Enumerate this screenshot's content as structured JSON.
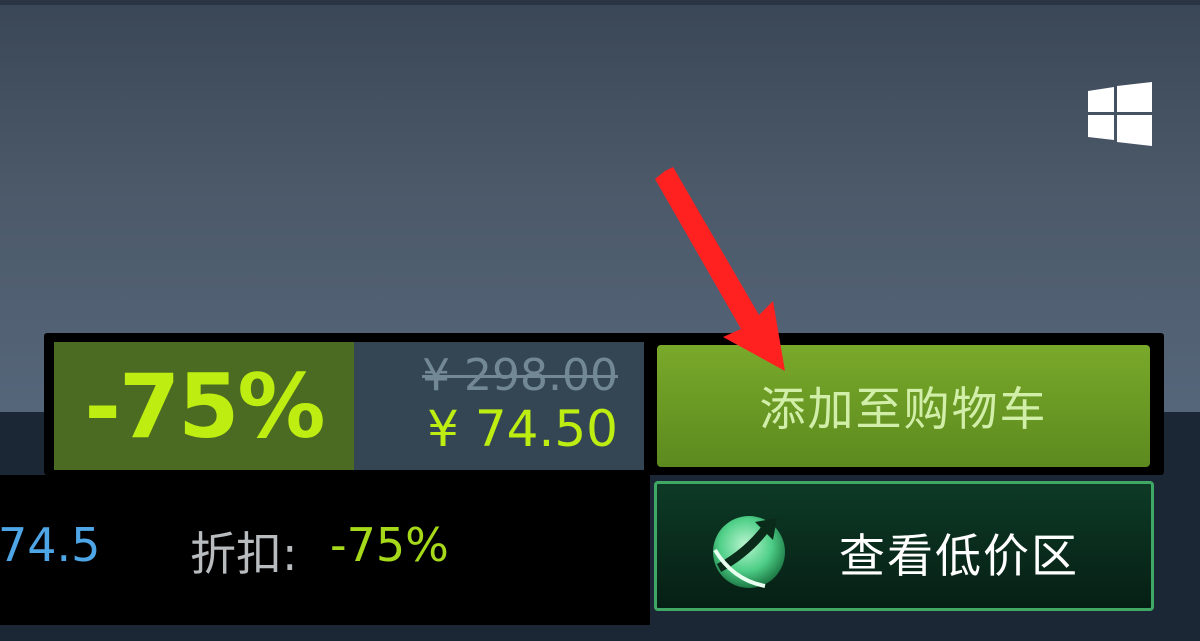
{
  "purchase": {
    "discount_percent": "-75%",
    "original_price": "¥ 298.00",
    "final_price": "¥ 74.50",
    "add_to_cart_label": "添加至购物车"
  },
  "info": {
    "lowest_price_fragment": "74.5",
    "discount_label": "折扣:",
    "discount_value": "-75%"
  },
  "low_price_zone": {
    "label": "查看低价区",
    "icon": "compass-arrow-icon"
  },
  "platform_icon": "windows-icon",
  "colors": {
    "discount_green": "#beee11",
    "cart_button": "#6b9a25",
    "price_bg": "#344654",
    "annotation_arrow": "#ff2a2a"
  }
}
